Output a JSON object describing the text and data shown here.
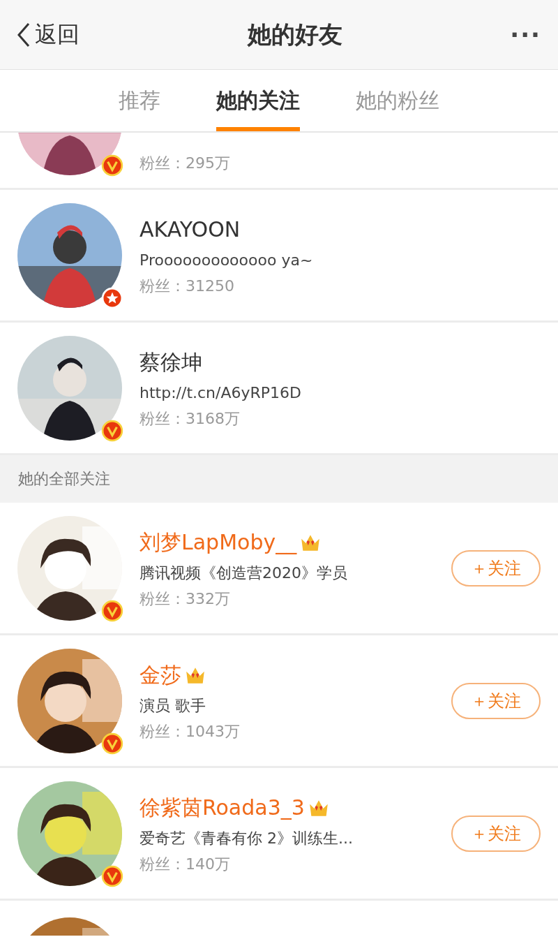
{
  "nav": {
    "back": "返回",
    "title": "她的好友",
    "more": "···"
  },
  "tabs": [
    {
      "label": "推荐",
      "selected": false
    },
    {
      "label": "她的关注",
      "selected": true
    },
    {
      "label": "她的粉丝",
      "selected": false
    }
  ],
  "featured": [
    {
      "fans": "粉丝：295万",
      "badge": {
        "kind": "verified"
      },
      "cut": true
    },
    {
      "name": "AKAYOON",
      "desc": "Prooooooooooooo ya~",
      "fans": "粉丝：31250",
      "badge": {
        "kind": "star"
      },
      "cut": false
    },
    {
      "name": "蔡徐坤",
      "desc": "http://t.cn/A6yRP16D",
      "fans": "粉丝：3168万",
      "badge": {
        "kind": "verified"
      },
      "cut": false
    }
  ],
  "section_title": "她的全部关注",
  "following": [
    {
      "name": "刘梦LapMoby__",
      "desc": "腾讯视频《创造营2020》学员",
      "fans": "粉丝：332万",
      "badge": {
        "kind": "verified"
      },
      "vip": true,
      "button": "＋关注"
    },
    {
      "name": "金莎",
      "desc": "演员 歌手",
      "fans": "粉丝：1043万",
      "badge": {
        "kind": "verified"
      },
      "vip": true,
      "button": "＋关注"
    },
    {
      "name": "徐紫茵Roada3_3",
      "desc": "爱奇艺《青春有你 2》训练生...",
      "fans": "粉丝：140万",
      "badge": {
        "kind": "verified"
      },
      "vip": true,
      "button": "＋关注"
    },
    {
      "kind": "picture"
    }
  ]
}
